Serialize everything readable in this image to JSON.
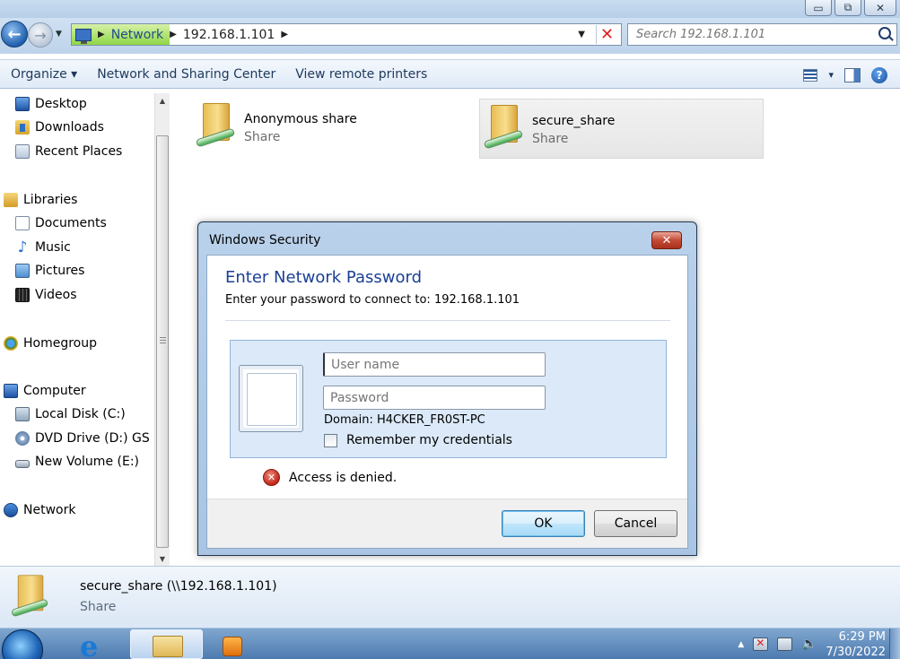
{
  "window": {
    "minimize_glyph": "▭",
    "maximize_glyph": "⧉",
    "close_glyph": "✕"
  },
  "address_bar": {
    "back_glyph": "←",
    "forward_glyph": "→",
    "crumbs": [
      "Network",
      "192.168.1.101"
    ],
    "search_placeholder": "Search 192.168.1.101"
  },
  "toolbar": {
    "organize": "Organize ▾",
    "network_sharing": "Network and Sharing Center",
    "view_printers": "View remote printers",
    "view_dropdown": "▾",
    "help": "?"
  },
  "sidebar": {
    "favorites": [
      {
        "label": "Desktop",
        "icon": "desktop-icon"
      },
      {
        "label": "Downloads",
        "icon": "downloads-icon"
      },
      {
        "label": "Recent Places",
        "icon": "recent-places-icon"
      }
    ],
    "libraries": {
      "label": "Libraries",
      "items": [
        {
          "label": "Documents",
          "icon": "documents-icon"
        },
        {
          "label": "Music",
          "icon": "music-icon"
        },
        {
          "label": "Pictures",
          "icon": "pictures-icon"
        },
        {
          "label": "Videos",
          "icon": "videos-icon"
        }
      ]
    },
    "homegroup": "Homegroup",
    "computer": {
      "label": "Computer",
      "items": [
        {
          "label": "Local Disk (C:)",
          "icon": "disk-icon"
        },
        {
          "label": "DVD Drive (D:) GS",
          "icon": "dvd-icon"
        },
        {
          "label": "New Volume (E:)",
          "icon": "volume-icon"
        }
      ]
    },
    "network": "Network"
  },
  "content": {
    "shares": [
      {
        "name": "Anonymous share",
        "type": "Share"
      },
      {
        "name": "secure_share",
        "type": "Share"
      }
    ]
  },
  "dialog": {
    "title": "Windows Security",
    "heading": "Enter Network Password",
    "subtitle": "Enter your password to connect to: 192.168.1.101",
    "username_placeholder": "User name",
    "password_placeholder": "Password",
    "domain": "Domain: H4CKER_FR0ST-PC",
    "remember": "Remember my credentials",
    "error": "Access is denied.",
    "ok": "OK",
    "cancel": "Cancel"
  },
  "details": {
    "name": "secure_share (\\\\192.168.1.101)",
    "type": "Share"
  },
  "taskbar": {
    "time": "6:29 PM",
    "date": "7/30/2022"
  },
  "colors": {
    "accent": "#1b3f94",
    "error": "#c0261a",
    "selection": "#e6e6e6"
  }
}
